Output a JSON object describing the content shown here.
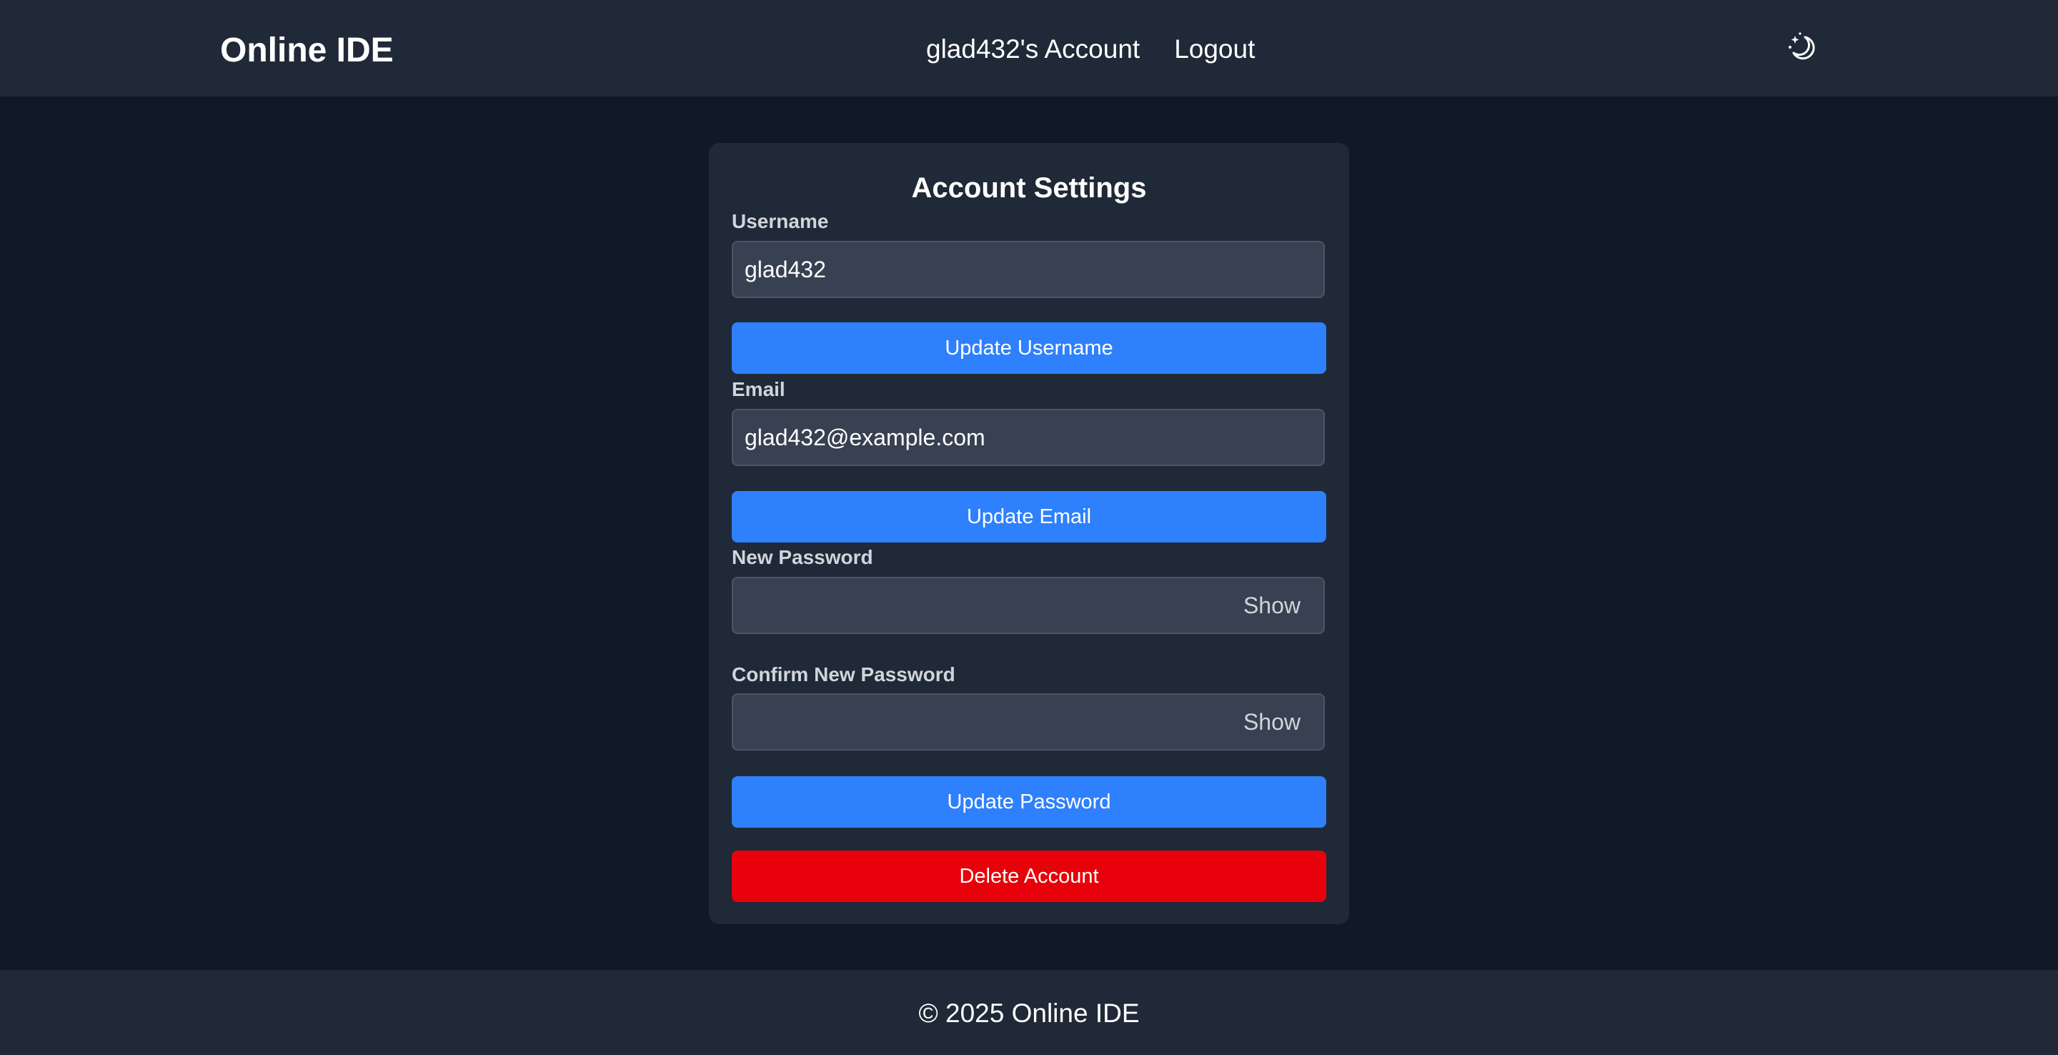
{
  "header": {
    "brand": "Online IDE",
    "nav": {
      "account_label": "glad432's Account",
      "logout_label": "Logout"
    },
    "theme_toggle_icon": "moon-stars-icon"
  },
  "settings": {
    "title": "Account Settings",
    "username": {
      "label": "Username",
      "value": "glad432",
      "button_label": "Update Username"
    },
    "email": {
      "label": "Email",
      "value": "glad432@example.com",
      "button_label": "Update Email"
    },
    "new_password": {
      "label": "New Password",
      "value": "",
      "show_label": "Show"
    },
    "confirm_password": {
      "label": "Confirm New Password",
      "value": "",
      "show_label": "Show"
    },
    "update_password_label": "Update Password",
    "delete_account_label": "Delete Account"
  },
  "footer": {
    "text": "© 2025 Online IDE"
  },
  "colors": {
    "page_background": "#111827",
    "panel_background": "#1f2937",
    "input_background": "#374151",
    "primary": "#2f80fc",
    "danger": "#e8000b"
  }
}
